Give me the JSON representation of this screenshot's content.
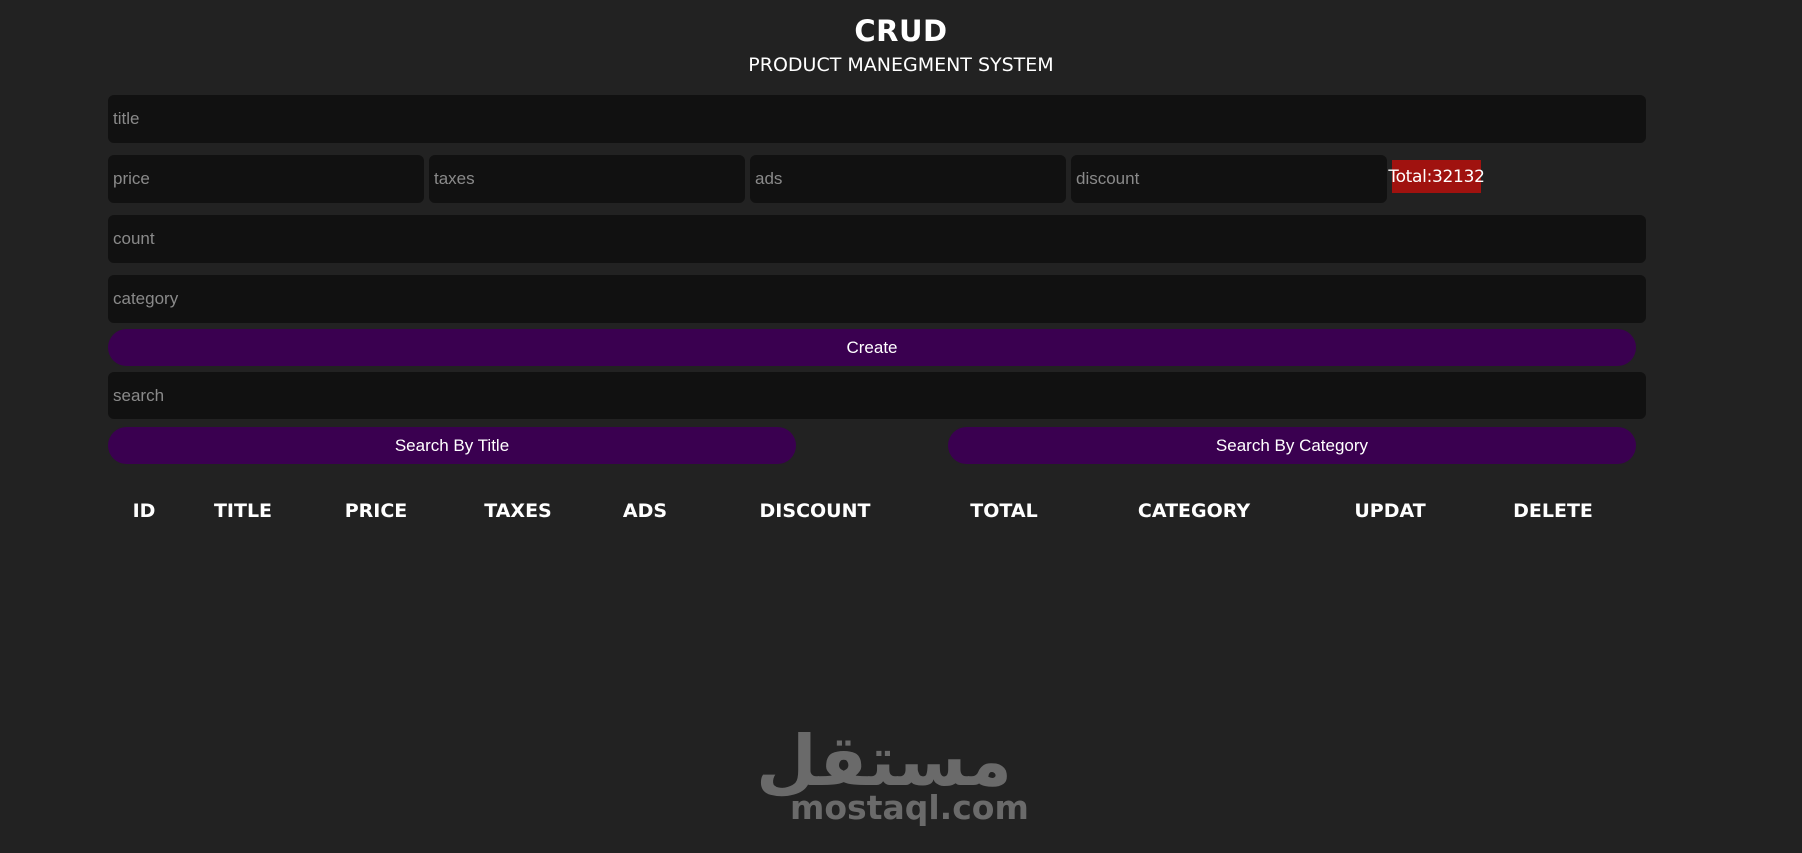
{
  "header": {
    "title": "CRUD",
    "subtitle": "PRODUCT MANEGMENT SYSTEM"
  },
  "form": {
    "title_placeholder": "title",
    "price_placeholder": "price",
    "taxes_placeholder": "taxes",
    "ads_placeholder": "ads",
    "discount_placeholder": "discount",
    "total_label": "Total:32132",
    "count_placeholder": "count",
    "category_placeholder": "category",
    "create_label": "Create"
  },
  "search": {
    "placeholder": "search",
    "by_title_label": "Search By Title",
    "by_category_label": "Search By Category"
  },
  "table": {
    "columns": [
      "ID",
      "TITLE",
      "PRICE",
      "TAXES",
      "ADS",
      "DISCOUNT",
      "TOTAL",
      "CATEGORY",
      "UPDAT",
      "DELETE"
    ]
  },
  "watermark": {
    "arabic": "مستقل",
    "latin": "mostaql.com"
  },
  "colors": {
    "background": "#222222",
    "input_bg": "#111111",
    "button_bg": "#3a0050",
    "total_bg": "#a0120f"
  }
}
